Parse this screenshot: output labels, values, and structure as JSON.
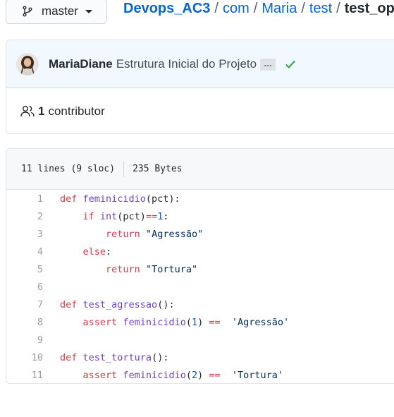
{
  "branch": {
    "label": "master"
  },
  "breadcrumb": {
    "repo": "Devops_AC3",
    "path": [
      "com",
      "Maria",
      "test"
    ],
    "file": "test_ope",
    "separator": "/"
  },
  "commit": {
    "author": "MariaDiane",
    "message": "Estrutura Inicial do Projeto",
    "ellipsis": "…",
    "status": "success"
  },
  "contributors": {
    "count": "1",
    "label": "contributor"
  },
  "file_info": {
    "lines": "11 lines (9 sloc)",
    "size": "235 Bytes"
  },
  "code_lines": [
    {
      "n": "1",
      "tokens": [
        [
          "kw",
          "def "
        ],
        [
          "fn",
          "feminicidio"
        ],
        [
          "",
          "(pct):"
        ]
      ]
    },
    {
      "n": "2",
      "tokens": [
        [
          "",
          "    "
        ],
        [
          "kw",
          "if "
        ],
        [
          "fn",
          "int"
        ],
        [
          "",
          "(pct)"
        ],
        [
          "op",
          "=="
        ],
        [
          "num",
          "1"
        ],
        [
          "",
          ":"
        ]
      ]
    },
    {
      "n": "3",
      "tokens": [
        [
          "",
          "        "
        ],
        [
          "kw",
          "return "
        ],
        [
          "str",
          "\"Agressão\""
        ]
      ]
    },
    {
      "n": "4",
      "tokens": [
        [
          "",
          "    "
        ],
        [
          "kw",
          "else"
        ],
        [
          "",
          ":"
        ]
      ]
    },
    {
      "n": "5",
      "tokens": [
        [
          "",
          "        "
        ],
        [
          "kw",
          "return "
        ],
        [
          "str",
          "\"Tortura\""
        ]
      ]
    },
    {
      "n": "6",
      "tokens": []
    },
    {
      "n": "7",
      "tokens": [
        [
          "kw",
          "def "
        ],
        [
          "fn",
          "test_agressao"
        ],
        [
          "",
          "():"
        ]
      ]
    },
    {
      "n": "8",
      "tokens": [
        [
          "",
          "    "
        ],
        [
          "kw",
          "assert "
        ],
        [
          "fn",
          "feminicidio"
        ],
        [
          "",
          "("
        ],
        [
          "num",
          "1"
        ],
        [
          "",
          ") "
        ],
        [
          "op",
          "=="
        ],
        [
          "",
          "  "
        ],
        [
          "str",
          "'Agressão'"
        ]
      ]
    },
    {
      "n": "9",
      "tokens": []
    },
    {
      "n": "10",
      "tokens": [
        [
          "kw",
          "def "
        ],
        [
          "fn",
          "test_tortura"
        ],
        [
          "",
          "():"
        ]
      ]
    },
    {
      "n": "11",
      "tokens": [
        [
          "",
          "    "
        ],
        [
          "kw",
          "assert "
        ],
        [
          "fn",
          "feminicidio"
        ],
        [
          "",
          "("
        ],
        [
          "num",
          "2"
        ],
        [
          "",
          ") "
        ],
        [
          "op",
          "=="
        ],
        [
          "",
          "  "
        ],
        [
          "str",
          "'Tortura'"
        ]
      ]
    }
  ],
  "colors": {
    "link": "#0366d6",
    "keyword": "#d73a49",
    "function": "#6f42c1",
    "string": "#032f62",
    "number": "#005cc5",
    "success": "#28a745"
  },
  "icons": {
    "branch": "git-branch-icon",
    "caret": "caret-down-icon",
    "contributors": "people-icon",
    "check": "check-icon"
  }
}
